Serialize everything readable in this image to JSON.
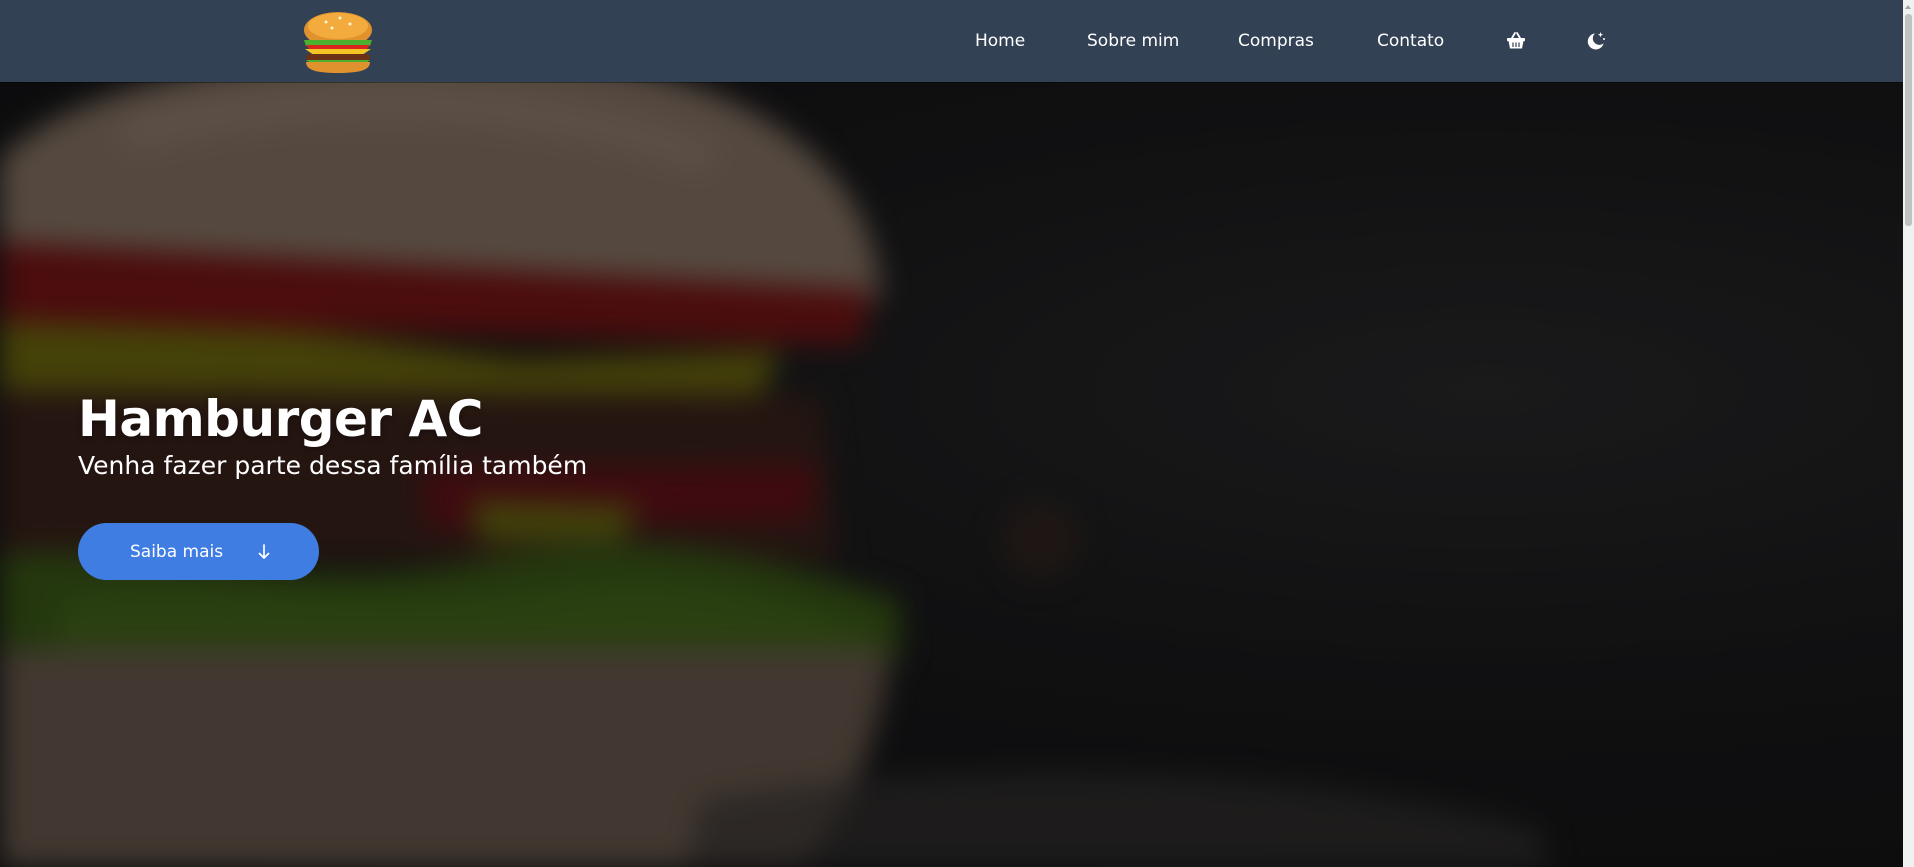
{
  "brand": {
    "logo_icon": "hamburger-logo-icon"
  },
  "nav": {
    "links": [
      {
        "label": "Home"
      },
      {
        "label": "Sobre mim"
      },
      {
        "label": "Compras"
      },
      {
        "label": "Contato"
      }
    ],
    "cart_icon": "basket-icon",
    "theme_icon": "moon-stars-icon"
  },
  "hero": {
    "title": "Hamburger AC",
    "subtitle": "Venha fazer parte dessa família também",
    "cta_label": "Saiba mais",
    "cta_icon": "arrow-down-icon",
    "background_image": "blurred-hamburger-photo"
  },
  "colors": {
    "navbar": "#334155",
    "cta": "#3f7de2",
    "text": "#ffffff"
  }
}
